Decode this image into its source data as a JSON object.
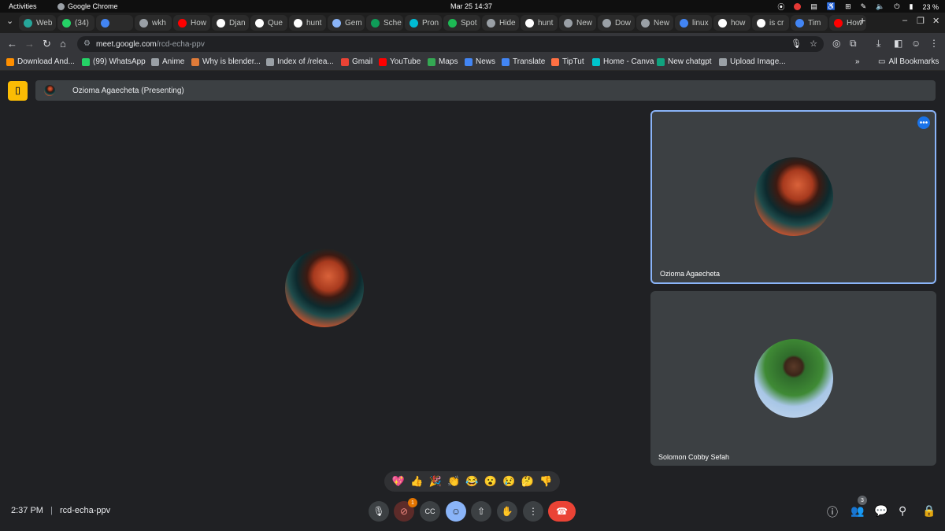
{
  "system": {
    "activities": "Activities",
    "app_name": "Google Chrome",
    "clock": "Mar 25  14:37",
    "battery": "23 %"
  },
  "tabs": [
    {
      "label": "Web",
      "color": "#26a69a"
    },
    {
      "label": "(34)",
      "color": "#25d366"
    },
    {
      "label": "",
      "color": "#4285f4"
    },
    {
      "label": "wkh",
      "color": "#9aa0a6"
    },
    {
      "label": "How",
      "color": "#ff0000"
    },
    {
      "label": "Djan",
      "color": "#ffffff"
    },
    {
      "label": "Que",
      "color": "#ffffff"
    },
    {
      "label": "hunt",
      "color": "#ffffff"
    },
    {
      "label": "Gem",
      "color": "#8ab4f8"
    },
    {
      "label": "Sche",
      "color": "#0f9d58"
    },
    {
      "label": "Pron",
      "color": "#00bcd4"
    },
    {
      "label": "Spot",
      "color": "#1db954"
    },
    {
      "label": "Hide",
      "color": "#9aa0a6"
    },
    {
      "label": "hunt",
      "color": "#ffffff"
    },
    {
      "label": "New",
      "color": "#9aa0a6"
    },
    {
      "label": "Dow",
      "color": "#9aa0a6"
    },
    {
      "label": "New",
      "color": "#9aa0a6"
    },
    {
      "label": "linux",
      "color": "#4285f4"
    },
    {
      "label": "how",
      "color": "#ffffff"
    },
    {
      "label": "is cr",
      "color": "#ffffff"
    },
    {
      "label": "Tim",
      "color": "#4285f4"
    },
    {
      "label": "How",
      "color": "#ff0000"
    }
  ],
  "address": {
    "host": "meet.google.com",
    "path": "/rcd-echa-ppv"
  },
  "bookmarks": [
    {
      "label": "Download And...",
      "color": "#ff8f00"
    },
    {
      "label": "(99) WhatsApp",
      "color": "#25d366"
    },
    {
      "label": "Anime",
      "color": "#9aa0a6"
    },
    {
      "label": "Why is blender...",
      "color": "#e07b39"
    },
    {
      "label": "Index of /relea...",
      "color": "#9aa0a6"
    },
    {
      "label": "Gmail",
      "color": "#ea4335"
    },
    {
      "label": "YouTube",
      "color": "#ff0000"
    },
    {
      "label": "Maps",
      "color": "#34a853"
    },
    {
      "label": "News",
      "color": "#4285f4"
    },
    {
      "label": "Translate",
      "color": "#4285f4"
    },
    {
      "label": "TipTut",
      "color": "#ff7043"
    },
    {
      "label": "Home - Canva",
      "color": "#00c4cc"
    },
    {
      "label": "New chatgpt",
      "color": "#10a37f"
    },
    {
      "label": "Upload Image...",
      "color": "#9aa0a6"
    }
  ],
  "all_bookmarks": "All Bookmarks",
  "meet": {
    "presenting_label": "Ozioma Agaecheta (Presenting)",
    "participants": [
      {
        "name": "Ozioma Agaecheta"
      },
      {
        "name": "Solomon Cobby Sefah"
      }
    ],
    "time": "2:37 PM",
    "separator": "|",
    "meeting_code": "rcd-echa-ppv",
    "people_count": "3",
    "notification_count": "1",
    "reactions": [
      "💖",
      "👍",
      "🎉",
      "👏",
      "😂",
      "😮",
      "😢",
      "🤔",
      "👎"
    ]
  }
}
